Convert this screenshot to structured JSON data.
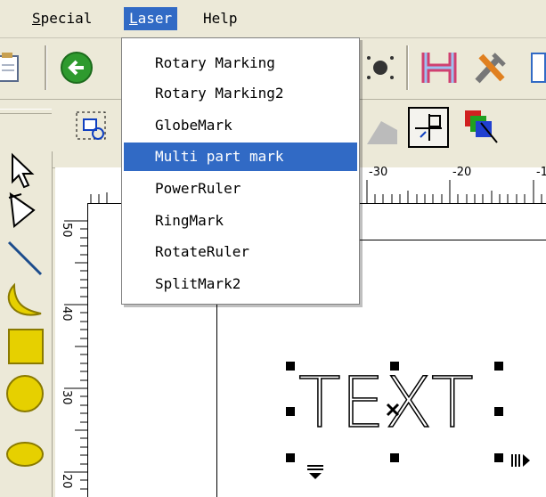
{
  "menubar": {
    "items": [
      {
        "label": "Special",
        "accel": "S",
        "rest": "pecial"
      },
      {
        "label": "Laser",
        "accel": "L",
        "rest": "aser"
      },
      {
        "label": "Help"
      }
    ]
  },
  "laser_menu": {
    "items": [
      {
        "label": "Rotary Marking"
      },
      {
        "label": "Rotary Marking2"
      },
      {
        "label": "GlobeMark"
      },
      {
        "label": "Multi part mark",
        "highlighted": true
      },
      {
        "label": "PowerRuler"
      },
      {
        "label": "RingMark"
      },
      {
        "label": "RotateRuler"
      },
      {
        "label": "SplitMark2"
      }
    ]
  },
  "ruler_horizontal": {
    "labels": [
      "-30",
      "-20",
      "-1"
    ]
  },
  "ruler_vertical": {
    "labels": [
      "50",
      "40",
      "30",
      "20"
    ]
  },
  "canvas": {
    "text_object": "TEXT"
  },
  "colors": {
    "menu_highlight": "#316ac5",
    "toolbar_bg": "#ece9d8"
  }
}
